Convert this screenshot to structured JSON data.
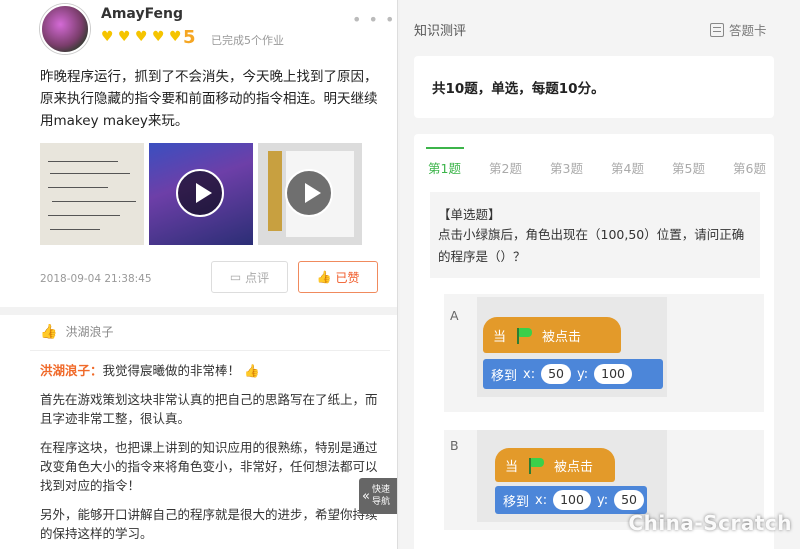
{
  "post": {
    "username": "AmayFeng",
    "score": "5",
    "completed": "已完成5个作业",
    "more": "• • •",
    "text": "昨晚程序运行，抓到了不会消失，今天晚上找到了原因，原来执行隐藏的指令要和前面移动的指令相连。明天继续用makey makey来玩。",
    "timestamp": "2018-09-04 21:38:45",
    "comment_label": "点评",
    "like_label": "已赞"
  },
  "likes": {
    "liker": "洪湖浪子"
  },
  "comment": {
    "author": "洪湖浪子：",
    "first_line": "我觉得宸曦做的非常棒！",
    "p1": "首先在游戏策划这块非常认真的把自己的思路写在了纸上，而且字迹非常工整，很认真。",
    "p2": "在程序这块，也把课上讲到的知识应用的很熟练，特别是通过改变角色大小的指令来将角色变小，非常好，任何想法都可以找到对应的指令！",
    "p3": "另外，能够开口讲解自己的程序就是很大的进步，希望你持续的保持这样的学习。"
  },
  "quick_nav": {
    "line1": "快速",
    "line2": "导航"
  },
  "quiz": {
    "title": "知识测评",
    "answer_card": "答题卡",
    "summary": "共10题，单选，每题10分。",
    "tabs": [
      "第1题",
      "第2题",
      "第3题",
      "第4题",
      "第5题",
      "第6题"
    ],
    "question_type": "【单选题】",
    "question_text": "点击小绿旗后，角色出现在（100,50）位置，请问正确的程序是（）？",
    "options": [
      {
        "letter": "A",
        "hat": "当",
        "hat_suffix": "被点击",
        "motion": "移到",
        "x_label": "x:",
        "x": "50",
        "y_label": "y:",
        "y": "100"
      },
      {
        "letter": "B",
        "hat": "当",
        "hat_suffix": "被点击",
        "motion": "移到",
        "x_label": "x:",
        "x": "100",
        "y_label": "y:",
        "y": "50"
      }
    ]
  },
  "watermark": "China-Scratch",
  "colors": {
    "accent_green": "#3cb44a",
    "like_orange": "#f05a28",
    "scratch_event": "#e39a2a",
    "scratch_motion": "#4c86d9"
  }
}
